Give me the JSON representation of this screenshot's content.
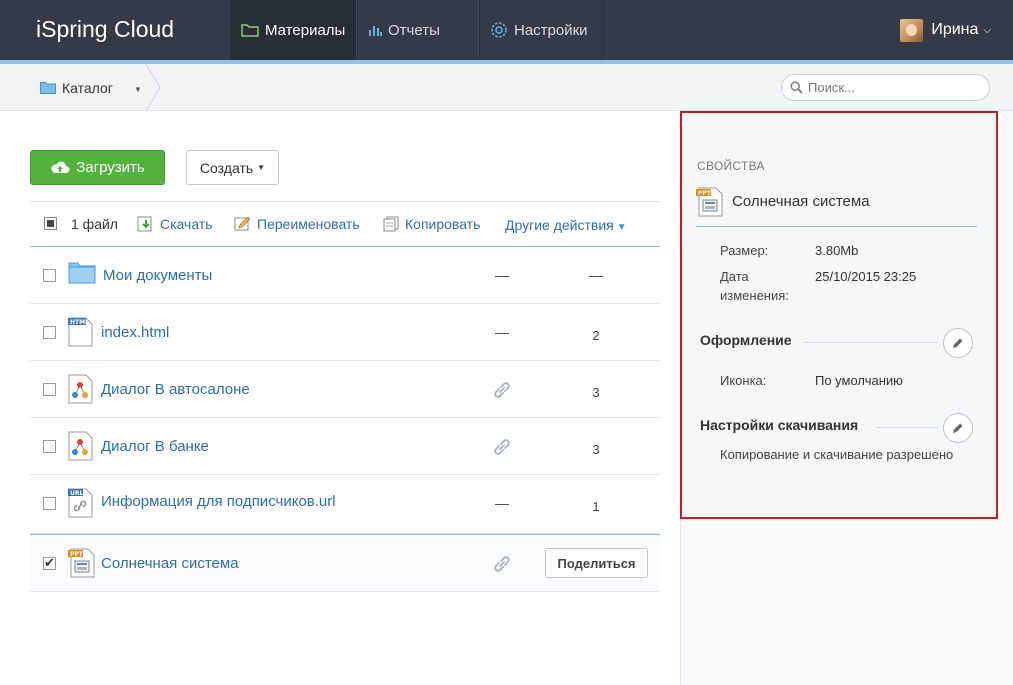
{
  "header": {
    "brand": "iSpring Cloud",
    "nav": [
      {
        "label": "Материалы",
        "icon": "folder-icon",
        "active": true
      },
      {
        "label": "Отчеты",
        "icon": "bar-chart-icon",
        "active": false
      },
      {
        "label": "Настройки",
        "icon": "gear-icon",
        "active": false
      }
    ],
    "user": {
      "name": "Ирина",
      "icon": "avatar"
    }
  },
  "breadcrumb": {
    "label": "Каталог",
    "icon": "folder-icon"
  },
  "search": {
    "placeholder": "Поиск..."
  },
  "actions": {
    "upload_label": "Загрузить",
    "create_label": "Создать"
  },
  "toolbar": {
    "count": "1 файл",
    "download": "Скачать",
    "rename": "Переименовать",
    "copy": "Копировать",
    "more": "Другие действия"
  },
  "files": [
    {
      "name": "Мои документы",
      "type": "folder",
      "col1": "—",
      "col2": "—",
      "checked": false
    },
    {
      "name": "index.html",
      "type": "html",
      "col1": "—",
      "col2": "2",
      "checked": false
    },
    {
      "name": "Диалог В автосалоне",
      "type": "dialog",
      "col1": "link-icon",
      "col2": "3",
      "checked": false
    },
    {
      "name": "Диалог В банке",
      "type": "dialog",
      "col1": "link-icon",
      "col2": "3",
      "checked": false
    },
    {
      "name": "Информация для подписчиков.url",
      "type": "url",
      "col1": "—",
      "col2": "1",
      "checked": false
    },
    {
      "name": "Солнечная система",
      "type": "ppt",
      "col1": "link-icon",
      "share_label": "Поделиться",
      "checked": true
    }
  ],
  "properties": {
    "heading": "СВОЙСТВА",
    "title": "Солнечная система",
    "size_label": "Размер:",
    "size_value": "3.80Mb",
    "date_label_1": "Дата",
    "date_label_2": "изменения:",
    "date_value": "25/10/2015 23:25",
    "design_heading": "Оформление",
    "icon_label": "Иконка:",
    "icon_value": "По умолчанию",
    "download_heading": "Настройки скачивания",
    "download_note": "Копирование и скачивание разрешено"
  },
  "colors": {
    "topbar": "#343b46",
    "accent_blue": "#2f6fa7",
    "upload_green": "#53b13d",
    "highlight_red": "#b52427"
  }
}
